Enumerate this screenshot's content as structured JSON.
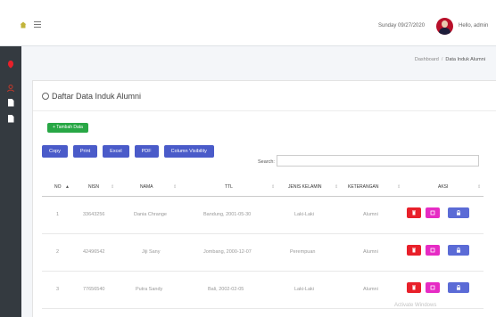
{
  "navbar": {
    "date": "Sunday 09/27/2020",
    "user": "Hello, admin"
  },
  "breadcrumb": {
    "home": "Dashboard",
    "separator": "/",
    "current": "Data Induk Alumni"
  },
  "card": {
    "title": "Daftar Data Induk Alumni",
    "add_button": "+ Tambah Data"
  },
  "toolbar": {
    "buttons": [
      "Copy",
      "Print",
      "Excel",
      "PDF",
      "Column Visibility"
    ],
    "search_label": "Search:"
  },
  "table": {
    "headers": [
      "NO",
      "NISN",
      "NAMA",
      "TTL",
      "JENIS KELAMIN",
      "KETERANGAN",
      "AKSI"
    ],
    "rows": [
      {
        "no": "1",
        "nisn": "33643256",
        "nama": "Dania Chrange",
        "ttl": "Bandung, 2001-05-30",
        "jk": "Laki-Laki",
        "ket": "Alumni"
      },
      {
        "no": "2",
        "nisn": "42496542",
        "nama": "Jiji Sany",
        "ttl": "Jombang, 2000-12-07",
        "jk": "Perempuan",
        "ket": "Alumni"
      },
      {
        "no": "3",
        "nisn": "77656540",
        "nama": "Putra Sandy",
        "ttl": "Bali, 2002-02-05",
        "jk": "Laki-Laki",
        "ket": "Alumni"
      }
    ]
  },
  "watermark": "Activate Windows",
  "colors": {
    "sidebar": "#343a40",
    "primary_button": "#4a5bc9",
    "success": "#28a745",
    "danger": "#e8202a",
    "pink": "#e62bc4",
    "info": "#5b6bd6"
  },
  "icons": [
    "home-icon",
    "menu-icon",
    "avatar",
    "dashboard-icon",
    "file-icon",
    "trash-icon",
    "edit-icon",
    "lock-icon"
  ]
}
